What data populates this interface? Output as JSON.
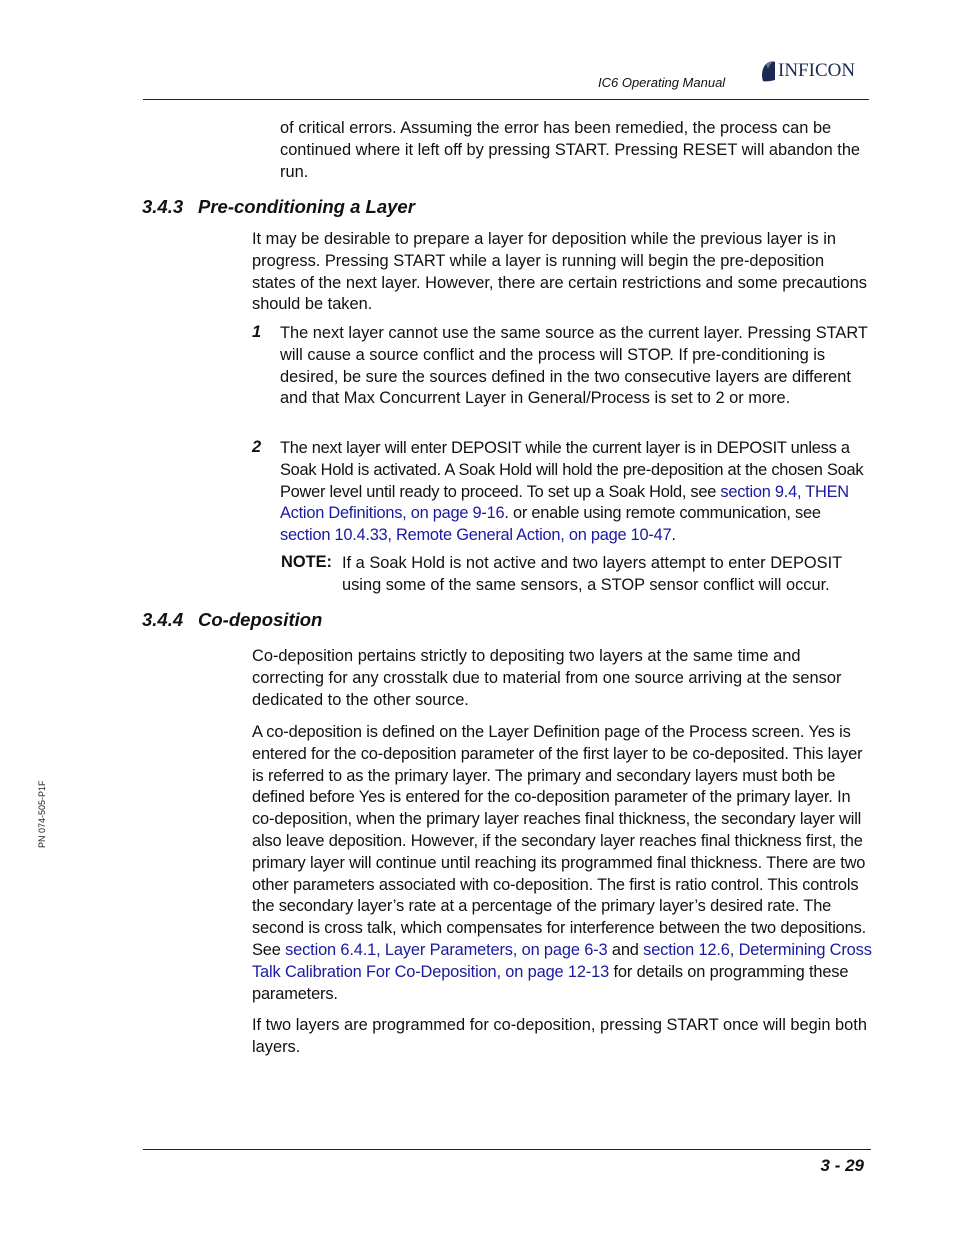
{
  "header": {
    "manual_title": "IC6 Operating Manual",
    "logo_text": "INFICON",
    "logo_icon": "inficon-logo-mark"
  },
  "sidebar_code": "PN 074-505-P1F",
  "page_number": "3 - 29",
  "intro_paragraph": "of critical errors. Assuming the error has been remedied, the process can be continued where it left off by pressing START. Pressing RESET will abandon the run.",
  "section_343": {
    "number": "3.4.3",
    "title": "Pre-conditioning a Layer",
    "paragraph": "It may be desirable to prepare a layer for deposition while the previous layer is in progress. Pressing START while a layer is running will begin the pre-deposition states of the next layer. However, there are certain restrictions and some precautions should be taken.",
    "items": [
      {
        "number": "1",
        "text": "The next layer cannot use the same source as the current layer. Pressing START will cause a source conflict and the process will STOP. If pre-conditioning is desired, be sure the sources defined in the two consecutive layers are different and that Max Concurrent Layer in General/Process is set to 2 or more."
      },
      {
        "number": "2",
        "text_a": "The next layer will enter DEPOSIT while the current layer is in DEPOSIT unless a Soak Hold is activated. A Soak Hold will hold the pre-deposition at the chosen Soak Power level until ready to proceed. To set up a Soak Hold, see ",
        "link_1": "section 9.4, THEN Action Definitions, on page 9-16",
        "text_b": ". or enable using remote communication, see ",
        "link_2": "section 10.4.33, Remote General Action, on page 10-47",
        "text_c": "."
      }
    ],
    "note": {
      "label": "NOTE:",
      "text": "If a Soak Hold is not active and two layers attempt to enter DEPOSIT using some of the same sensors, a STOP sensor conflict will occur."
    }
  },
  "section_344": {
    "number": "3.4.4",
    "title": "Co-deposition",
    "paragraph_1": "Co-deposition pertains strictly to depositing two layers at the same time and correcting for any crosstalk due to material from one source arriving at the sensor dedicated to the other source.",
    "paragraph_2_a": "A co-deposition is defined on the Layer Definition page of the Process screen. Yes is entered for the co-deposition parameter of the first layer to be co-deposited. This layer is referred to as the primary layer. The primary and secondary layers must both be defined before Yes is entered for the co-deposition parameter of the primary layer. In co-deposition, when the primary layer reaches final thickness, the secondary layer will also leave deposition. However, if the secondary layer reaches final thickness first, the primary layer will continue until reaching its programmed final thickness. There are two other parameters associated with co-deposition. The first is ratio control. This controls the secondary layer’s rate at a percentage of the primary layer’s desired rate. The second is cross talk, which compensates for interference between the two depositions. See ",
    "link_1": "section 6.4.1, Layer Parameters, on page 6-3",
    "paragraph_2_b": " and ",
    "link_2": "section 12.6, Determining Cross Talk Calibration For Co-Deposition, on page 12-13",
    "paragraph_2_c": " for details on programming these parameters.",
    "paragraph_3": "If two layers are programmed for co-deposition, pressing START once will begin both layers."
  }
}
